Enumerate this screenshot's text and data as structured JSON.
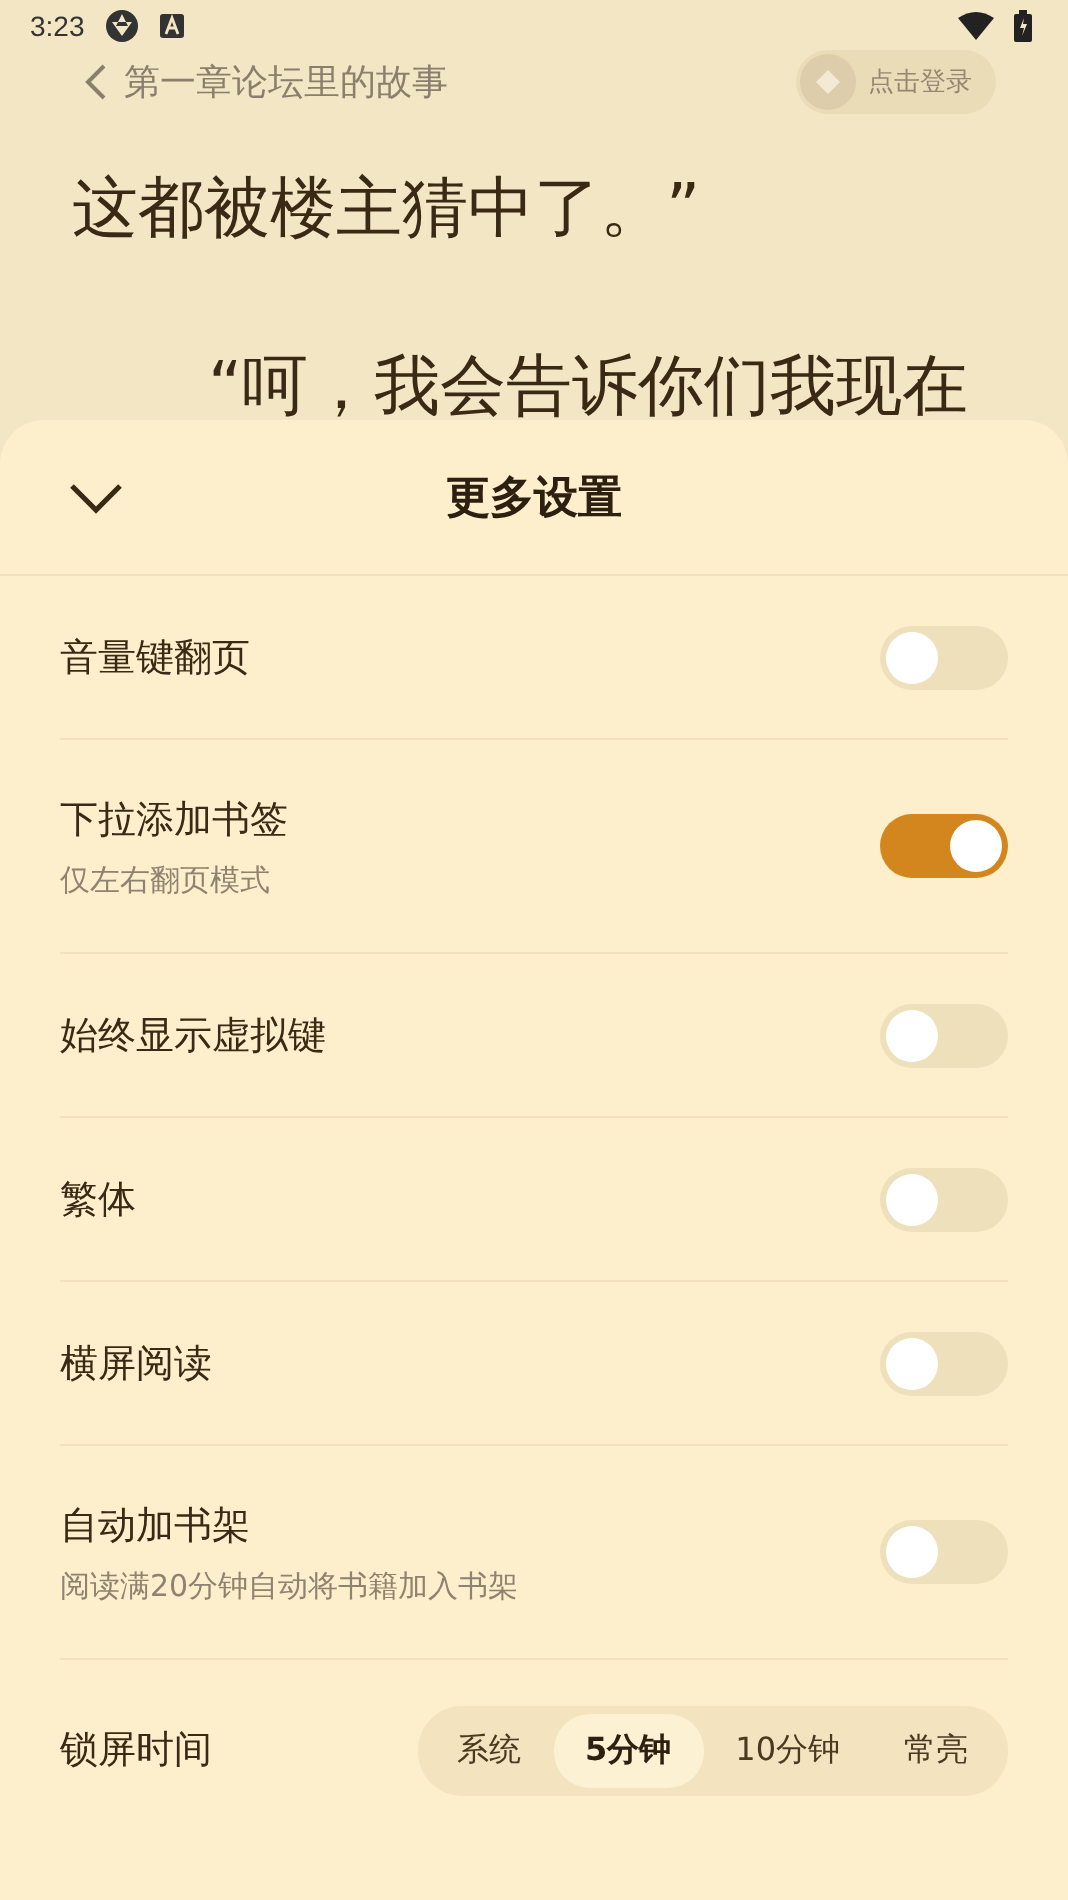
{
  "status_bar": {
    "time": "3:23"
  },
  "reader": {
    "chapter_title": "第一章论坛里的故事",
    "login_button": "点击登录",
    "lines": [
      "这都被楼主猜中了。”",
      "“呵，我会告诉你们我现在"
    ]
  },
  "sheet": {
    "title": "更多设置",
    "settings": [
      {
        "label": "音量键翻页",
        "on": false
      },
      {
        "label": "下拉添加书签",
        "hint": "仅左右翻页模式",
        "on": true
      },
      {
        "label": "始终显示虚拟键",
        "on": false
      },
      {
        "label": "繁体",
        "on": false
      },
      {
        "label": "横屏阅读",
        "on": false
      },
      {
        "label": "自动加书架",
        "hint": "阅读满20分钟自动将书籍加入书架",
        "on": false
      }
    ],
    "lock_screen": {
      "label": "锁屏时间",
      "options": [
        {
          "label": "系统",
          "selected": false
        },
        {
          "label": "5分钟",
          "selected": true
        },
        {
          "label": "10分钟",
          "selected": false
        },
        {
          "label": "常亮",
          "selected": false
        }
      ]
    }
  }
}
